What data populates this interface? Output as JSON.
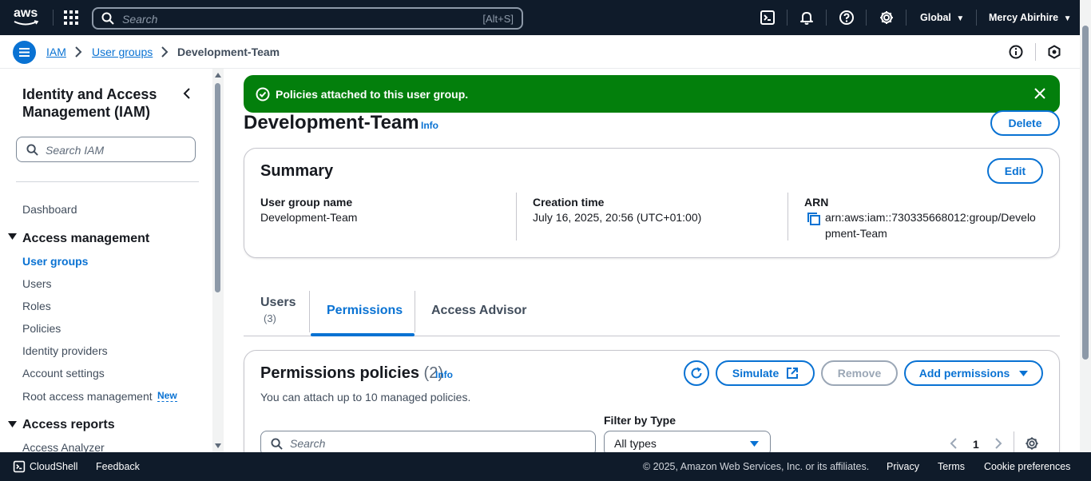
{
  "topnav": {
    "logo_text": "aws",
    "search_placeholder": "Search",
    "search_shortcut": "[Alt+S]",
    "region": "Global",
    "user": "Mercy Abirhire",
    "icons": [
      "cloudshell-icon",
      "bell-icon",
      "help-icon",
      "gear-icon"
    ]
  },
  "breadcrumb": {
    "items": [
      "IAM",
      "User groups",
      "Development-Team"
    ]
  },
  "sidebar": {
    "title": "Identity and Access Management (IAM)",
    "search_placeholder": "Search IAM",
    "dashboard": "Dashboard",
    "access_management": {
      "label": "Access management",
      "items": [
        "User groups",
        "Users",
        "Roles",
        "Policies",
        "Identity providers",
        "Account settings",
        "Root access management"
      ],
      "active": "User groups",
      "new_badge": "New"
    },
    "access_reports": {
      "label": "Access reports",
      "items": [
        "Access Analyzer"
      ]
    }
  },
  "flash": {
    "message": "Policies attached to this user group."
  },
  "page": {
    "title": "Development-Team",
    "info": "Info",
    "delete_label": "Delete"
  },
  "summary": {
    "title": "Summary",
    "edit_label": "Edit",
    "group_name_key": "User group name",
    "group_name_val": "Development-Team",
    "creation_key": "Creation time",
    "creation_val": "July 16, 2025, 20:56 (UTC+01:00)",
    "arn_key": "ARN",
    "arn_line1": "arn:aws:iam::730335668012:group/Develo",
    "arn_line2": "pment-Team"
  },
  "tabs": [
    {
      "label": "Users",
      "count": "(3)"
    },
    {
      "label": "Permissions"
    },
    {
      "label": "Access Advisor"
    }
  ],
  "permissions": {
    "title": "Permissions policies",
    "count": "(2)",
    "info": "Info",
    "subtitle": "You can attach up to 10 managed policies.",
    "simulate_label": "Simulate",
    "remove_label": "Remove",
    "add_label": "Add permissions",
    "filter_label": "Filter by Type",
    "search_placeholder": "Search",
    "filter_value": "All types",
    "page": "1"
  },
  "footer": {
    "cloudshell": "CloudShell",
    "feedback": "Feedback",
    "copyright": "© 2025, Amazon Web Services, Inc. or its affiliates.",
    "privacy": "Privacy",
    "terms": "Terms",
    "cookies": "Cookie preferences"
  }
}
